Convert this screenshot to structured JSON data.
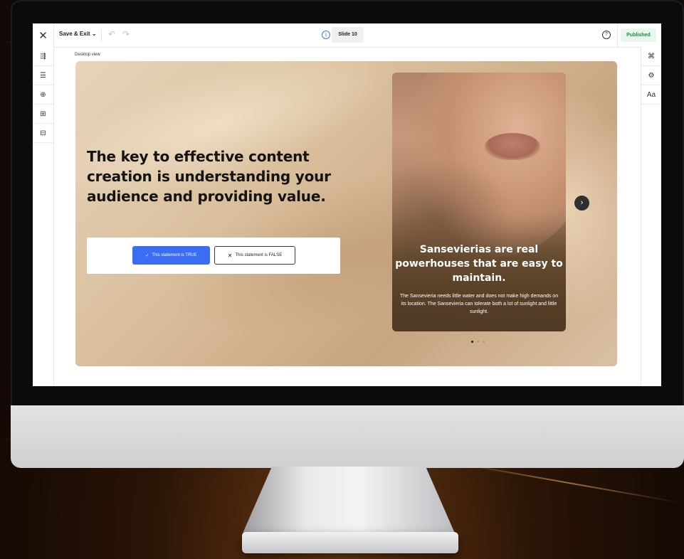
{
  "toolbar": {
    "close_icon": "close-icon",
    "save_exit_label": "Save & Exit",
    "save_exit_chevron": "⌄",
    "undo_icon": "undo-icon",
    "redo_icon": "redo-icon",
    "info_icon": "info-icon",
    "slide_label": "Slide 10",
    "help_icon": "help-icon",
    "status_label": "Published"
  },
  "left_tools": [
    {
      "icon": "collapse-sidebar-icon",
      "glyph": "⇶"
    },
    {
      "icon": "layers-icon",
      "glyph": "☰"
    },
    {
      "icon": "add-circle-icon",
      "glyph": "⊕"
    },
    {
      "icon": "grid-icon",
      "glyph": "⊞"
    },
    {
      "icon": "layout-icon",
      "glyph": "⊟"
    }
  ],
  "right_tools": [
    {
      "icon": "flow-icon",
      "glyph": "⌘"
    },
    {
      "icon": "settings-icon",
      "glyph": "⚙"
    },
    {
      "icon": "typography-icon",
      "glyph": "Aa"
    }
  ],
  "canvas": {
    "view_label": "Desktop view"
  },
  "slide": {
    "headline": "The key to effective content creation is understanding your audience and providing value.",
    "true_button_label": "This statement is TRUE",
    "false_button_label": "This statement is FALSE",
    "card": {
      "title": "Sansevierias are real powerhouses that are easy to maintain.",
      "text": "The Sansevieria needs little water and does not make high demands on its location. The Sansevieria can tolerate both a lot of sunlight and little sunlight."
    },
    "carousel": {
      "total_dots": 3,
      "active_index": 0
    }
  },
  "colors": {
    "primary_button": "#3b6df2",
    "published_text": "#1f8a43",
    "published_bg": "#e9f6ec"
  }
}
